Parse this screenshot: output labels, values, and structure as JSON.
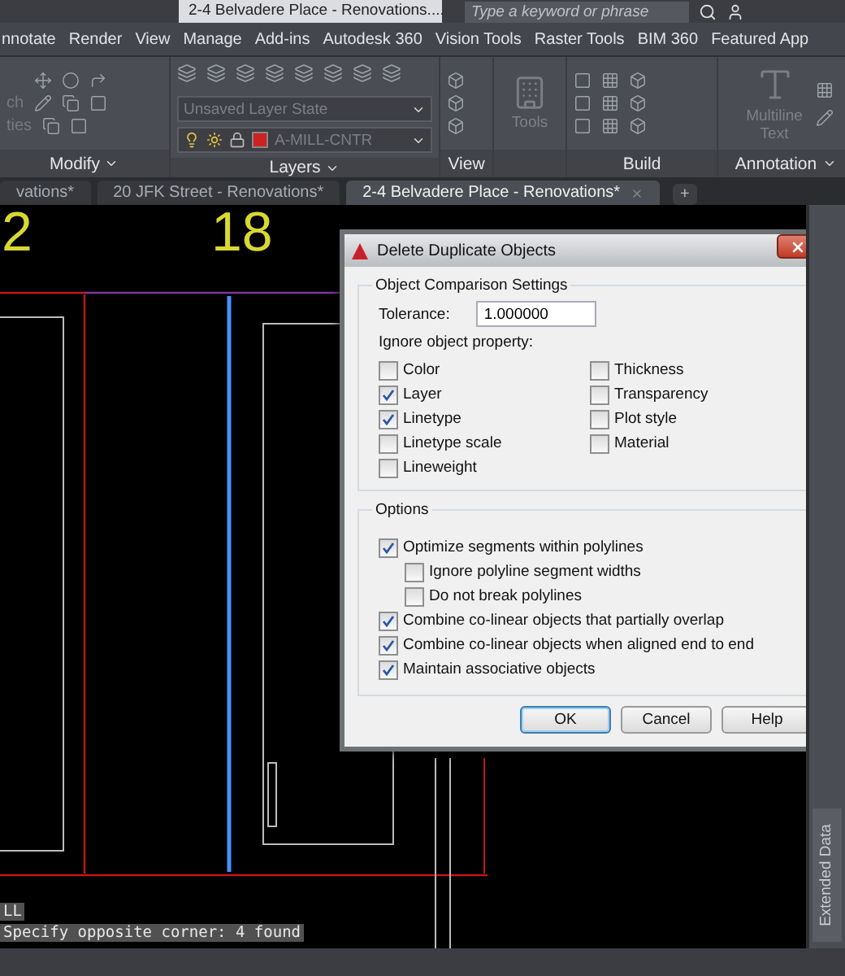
{
  "quick_access": {
    "title": "2-4 Belvadere Place - Renovations....",
    "search": {
      "placeholder": "Type a keyword or phrase"
    }
  },
  "ribbon_tabs": [
    {
      "label": "nnotate"
    },
    {
      "label": "Render"
    },
    {
      "label": "View"
    },
    {
      "label": "Manage"
    },
    {
      "label": "Add-ins"
    },
    {
      "label": "Autodesk 360"
    },
    {
      "label": "Vision Tools"
    },
    {
      "label": "Raster Tools"
    },
    {
      "label": "BIM 360"
    },
    {
      "label": "Featured App"
    }
  ],
  "ribbon_panels": {
    "modify": {
      "title": "Modify",
      "menu": true,
      "partial_labels": [
        "ch",
        "ties"
      ]
    },
    "layers": {
      "title": "Layers",
      "menu": true,
      "layer_state": "Unsaved Layer State",
      "current_layer": "A-MILL-CNTR"
    },
    "view": {
      "title": "View"
    },
    "tools": {
      "label": "Tools"
    },
    "build": {
      "title": "Build"
    },
    "annotation": {
      "title": "Annotation",
      "menu": true,
      "text_tool": "Multiline Text"
    }
  },
  "file_tabs": [
    {
      "label": "vations*",
      "selected": false
    },
    {
      "label": "20 JFK Street - Renovations*",
      "selected": false
    },
    {
      "label": "2-4 Belvadere Place - Renovations*",
      "selected": true
    }
  ],
  "new_tab": "+",
  "drawing": {
    "labels": [
      "2",
      "18"
    ]
  },
  "command_line": {
    "history": "LL",
    "prompt": "Specify opposite corner: 4 found"
  },
  "side_palette": {
    "tab": "Extended Data"
  },
  "dialog": {
    "title": "Delete Duplicate Objects",
    "comparison": {
      "legend": "Object Comparison Settings",
      "tolerance_label": "Tolerance:",
      "tolerance_value": "1.000000",
      "ignore_label": "Ignore object property:",
      "properties": [
        {
          "label": "Color",
          "checked": false
        },
        {
          "label": "Layer",
          "checked": true
        },
        {
          "label": "Linetype",
          "checked": true
        },
        {
          "label": "Linetype scale",
          "checked": false
        },
        {
          "label": "Lineweight",
          "checked": false
        },
        {
          "label": "Thickness",
          "checked": false
        },
        {
          "label": "Transparency",
          "checked": false
        },
        {
          "label": "Plot style",
          "checked": false
        },
        {
          "label": "Material",
          "checked": false
        }
      ]
    },
    "options": {
      "legend": "Options",
      "items": [
        {
          "label": "Optimize segments within polylines",
          "checked": true,
          "children": [
            {
              "label": "Ignore polyline segment widths",
              "checked": false
            },
            {
              "label": "Do not break polylines",
              "checked": false
            }
          ]
        },
        {
          "label": "Combine co-linear objects that partially overlap",
          "checked": true
        },
        {
          "label": "Combine co-linear objects when aligned end to end",
          "checked": true
        },
        {
          "label": "Maintain associative objects",
          "checked": true
        }
      ]
    },
    "buttons": [
      {
        "label": "OK",
        "default": true
      },
      {
        "label": "Cancel",
        "default": false
      },
      {
        "label": "Help",
        "default": false
      }
    ]
  }
}
